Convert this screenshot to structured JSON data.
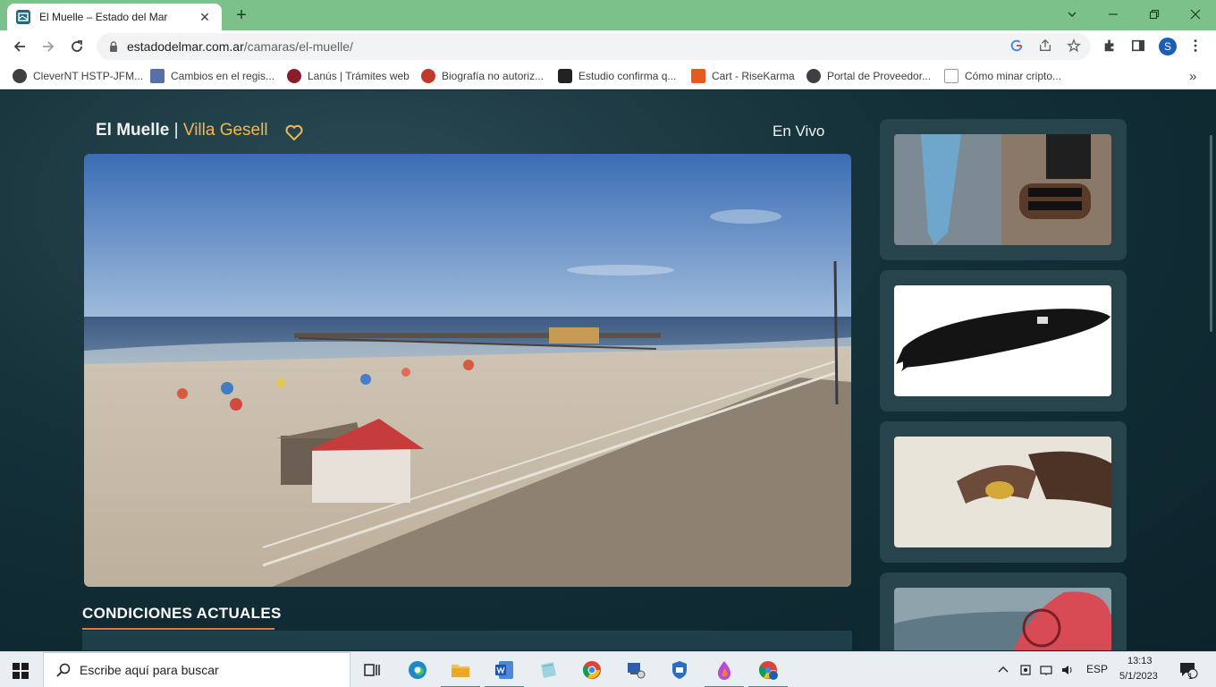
{
  "browser": {
    "tab_title": "El Muelle – Estado del Mar",
    "url_host": "estadodelmar.com.ar",
    "url_path": "/camaras/el-muelle/",
    "profile_initial": "S",
    "bookmarks": [
      {
        "label": "CleverNT HSTP-JFM...",
        "icon": "globe-icon"
      },
      {
        "label": "Cambios en el regis...",
        "icon": "bookmark-icon"
      },
      {
        "label": "Lanús | Trámites web",
        "icon": "municipal-icon"
      },
      {
        "label": "Biografía no autoriz...",
        "icon": "fire-icon"
      },
      {
        "label": "Estudio confirma q...",
        "icon": "od-icon"
      },
      {
        "label": "Cart - RiseKarma",
        "icon": "rk-icon"
      },
      {
        "label": "Portal de Proveedor...",
        "icon": "globe-icon"
      },
      {
        "label": "Cómo minar cripto...",
        "icon": "c-icon"
      }
    ],
    "more_bookmarks": "»"
  },
  "page": {
    "camera_name": "El Muelle",
    "separator": "|",
    "location": "Villa Gesell",
    "live_label": "En Vivo",
    "conditions_title": "CONDICIONES ACTUALES"
  },
  "taskbar": {
    "search_placeholder": "Escribe aquí para buscar",
    "language": "ESP",
    "time": "13:13",
    "date": "5/1/2023",
    "notification_count": "1"
  },
  "colors": {
    "accent": "#f0b84f",
    "underline": "#e2774a",
    "tab_strip": "#7cc08a"
  }
}
